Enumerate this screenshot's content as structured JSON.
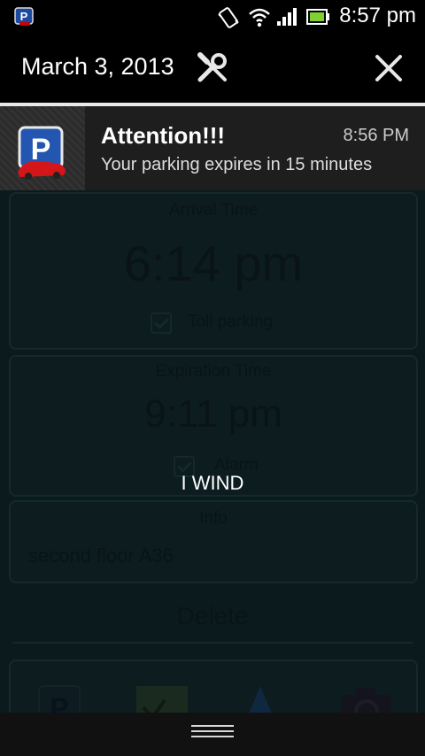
{
  "status_bar": {
    "time": "8:57 pm",
    "app_icon": "parking-app-icon"
  },
  "shade": {
    "date": "March 3, 2013"
  },
  "notification": {
    "title": "Attention!!!",
    "time": "8:56 PM",
    "text": "Your parking expires in 15 minutes"
  },
  "app": {
    "arrival": {
      "label": "Arrival Time",
      "time": "6:14 pm",
      "checkbox_label": "Toll parking",
      "checked": true
    },
    "expiration": {
      "label": "Expiration Time",
      "time": "9:11 pm",
      "checkbox_label": "Alarm",
      "checked": true
    },
    "info": {
      "label": "Info",
      "value": "second floor A36"
    },
    "delete_label": "Delete",
    "bottom_tabs": [
      "parking-icon",
      "map-icon",
      "navigation-arrow-icon",
      "camera-icon"
    ]
  },
  "carrier_label": "I WIND",
  "colors": {
    "notification_bg": "#1e1e1e",
    "shade_bg": "#000000",
    "app_dim_bg": "#0b1a1d"
  }
}
